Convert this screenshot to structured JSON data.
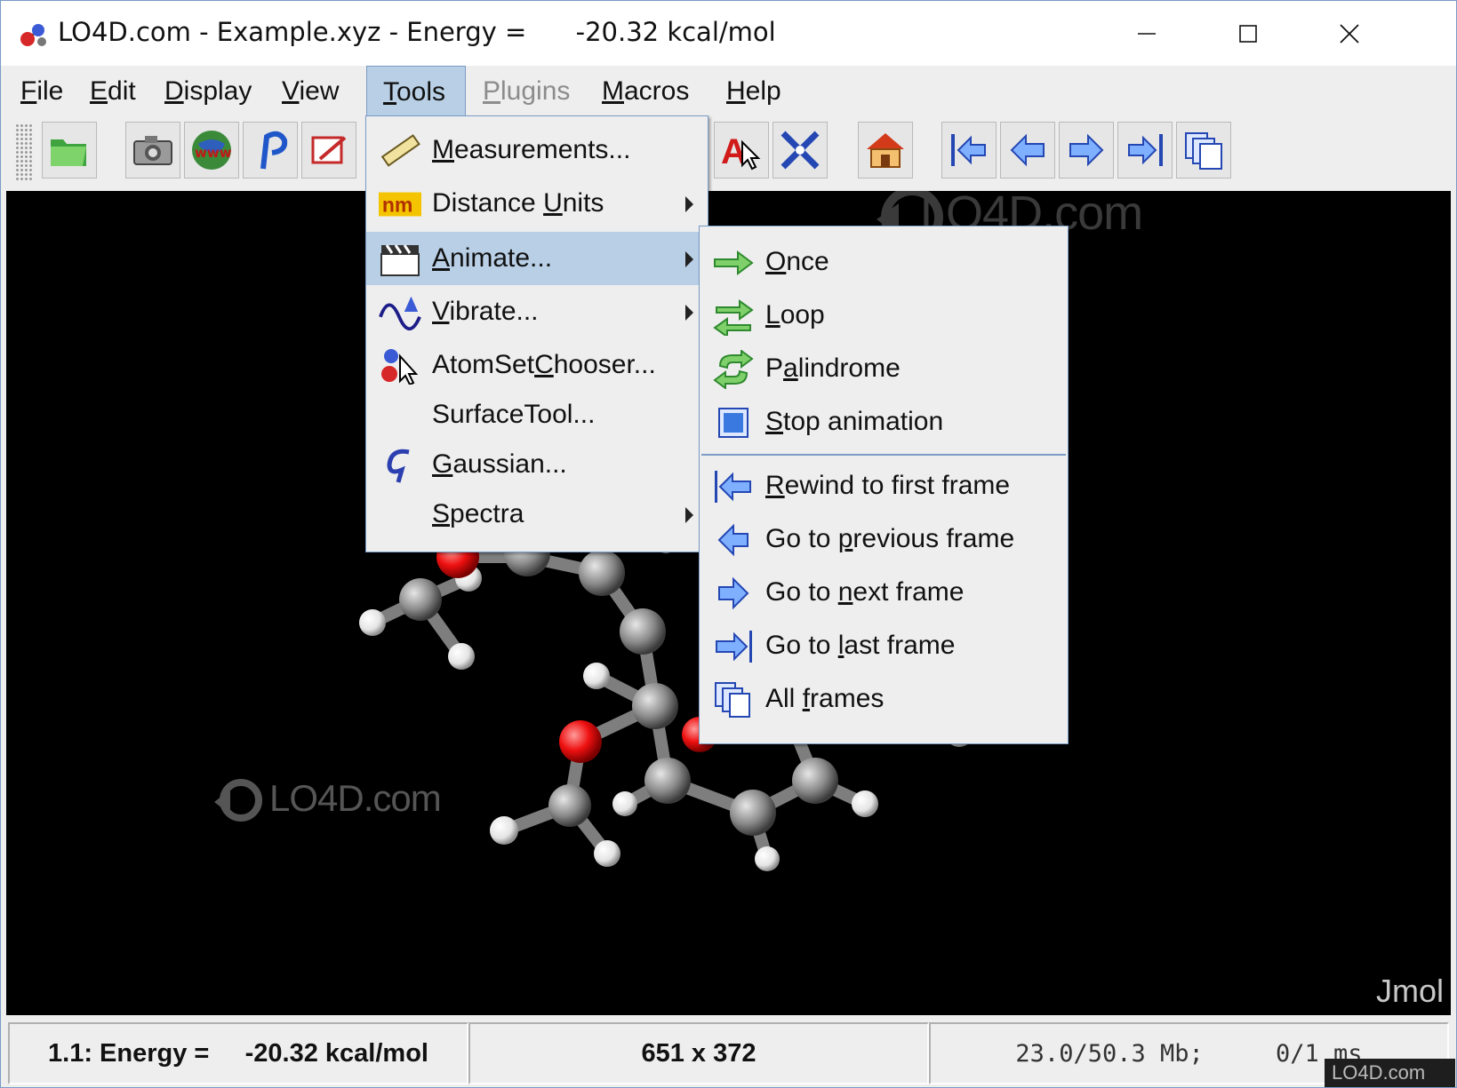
{
  "window": {
    "title": "LO4D.com - Example.xyz - Energy =      -20.32 kcal/mol",
    "app_icon": "jmol-molecule-icon"
  },
  "menubar": [
    {
      "label": "File",
      "mn": "F",
      "rest": "ile"
    },
    {
      "label": "Edit",
      "mn": "E",
      "rest": "dit"
    },
    {
      "label": "Display",
      "mn": "D",
      "rest": "isplay"
    },
    {
      "label": "View",
      "mn": "V",
      "rest": "iew"
    },
    {
      "label": "Tools",
      "mn": "T",
      "rest": "ools"
    },
    {
      "label": "Plugins",
      "mn": "P",
      "rest": "lugins"
    },
    {
      "label": "Macros",
      "mn": "M",
      "rest": "acros"
    },
    {
      "label": "Help",
      "mn": "H",
      "rest": "elp"
    }
  ],
  "toolbar": {
    "icons": [
      "open-folder-icon",
      "camera-icon",
      "www-globe-icon",
      "pick-cursor-icon",
      "edit-script-icon",
      "label-atoms-icon",
      "rotate-axes-icon",
      "home-icon",
      "first-frame-icon",
      "previous-frame-icon",
      "next-frame-icon",
      "last-frame-icon",
      "all-frames-icon"
    ]
  },
  "tools_menu": {
    "items": [
      {
        "pre": "",
        "mn": "M",
        "post": "easurements...",
        "icon": "ruler-icon",
        "submenu": false
      },
      {
        "pre": "Distance ",
        "mn": "U",
        "post": "nits",
        "icon": "nm-units-icon",
        "submenu": true
      },
      {
        "pre": "",
        "mn": "A",
        "post": "nimate...",
        "icon": "clapperboard-icon",
        "submenu": true
      },
      {
        "pre": "",
        "mn": "V",
        "post": "ibrate...",
        "icon": "vibration-wave-icon",
        "submenu": true
      },
      {
        "pre": "AtomSet",
        "mn": "C",
        "post": "hooser...",
        "icon": "atom-chooser-icon",
        "submenu": false
      },
      {
        "pre": "SurfaceTool...",
        "mn": "",
        "post": "",
        "icon": "",
        "submenu": false
      },
      {
        "pre": "",
        "mn": "G",
        "post": "aussian...",
        "icon": "gaussian-icon",
        "submenu": false
      },
      {
        "pre": "",
        "mn": "S",
        "post": "pectra",
        "icon": "",
        "submenu": true
      }
    ]
  },
  "animate_menu": {
    "items": [
      {
        "pre": "",
        "mn": "O",
        "post": "nce",
        "icon": "once-arrow-icon"
      },
      {
        "pre": "",
        "mn": "L",
        "post": "oop",
        "icon": "loop-arrows-icon"
      },
      {
        "pre": "P",
        "mn": "a",
        "post": "lindrome",
        "icon": "palindrome-arrows-icon"
      },
      {
        "pre": "",
        "mn": "S",
        "post": "top animation",
        "icon": "stop-square-icon"
      },
      {
        "pre": "",
        "mn": "R",
        "post": "ewind to first frame",
        "icon": "rewind-first-icon"
      },
      {
        "pre": "Go to ",
        "mn": "p",
        "post": "revious frame",
        "icon": "previous-arrow-icon"
      },
      {
        "pre": "Go to ",
        "mn": "n",
        "post": "ext frame",
        "icon": "next-arrow-icon"
      },
      {
        "pre": "Go to ",
        "mn": "l",
        "post": "ast frame",
        "icon": "last-frame-icon"
      },
      {
        "pre": "All ",
        "mn": "f",
        "post": "rames",
        "icon": "all-frames-icon"
      }
    ]
  },
  "viewer": {
    "brand_label": "Jmol",
    "watermark_top": "LO4D.com",
    "watermark_mid": "LO4D.com",
    "background": "#000000"
  },
  "statusbar": {
    "energy": "1.1: Energy =     -20.32 kcal/mol",
    "size": "651 x 372",
    "memory": "23.0/50.3 Mb;     0/1 ms"
  },
  "corner_watermark": "LO4D.com",
  "colors": {
    "accent_select": "#b8cfe5",
    "border": "#7a9cc6",
    "menu_bg": "#eeeeee"
  }
}
